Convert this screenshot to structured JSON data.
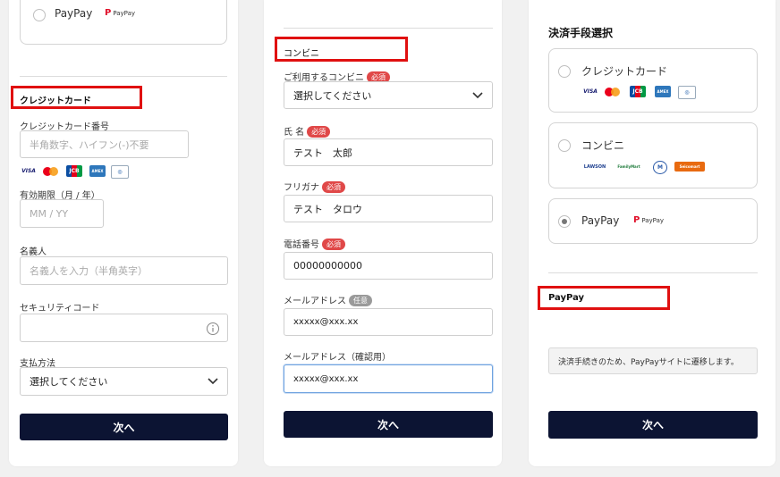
{
  "left_panel": {
    "top_option_label": "PayPay",
    "top_option_logo": "PayPay",
    "section_title": "クレジットカード",
    "card_number_label": "クレジットカード番号",
    "card_number_placeholder": "半角数字、ハイフン(-)不要",
    "card_brands": [
      "VISA",
      "Mastercard",
      "JCB",
      "AMEX",
      "Diners Club"
    ],
    "expiry_label": "有効期限（月 / 年）",
    "expiry_placeholder": "MM / YY",
    "name_label": "名義人",
    "name_placeholder": "名義人を入力（半角英字）",
    "security_label": "セキュリティコード",
    "payment_method_label": "支払方法",
    "payment_method_value": "選択してください",
    "next_button": "次へ"
  },
  "middle_panel": {
    "section_title": "コンビニ",
    "store_label": "ご利用するコンビニ",
    "required_badge": "必須",
    "optional_badge": "任意",
    "store_value": "選択してください",
    "name_label": "氏 名",
    "name_value": "テスト　太郎",
    "kana_label": "フリガナ",
    "kana_value": "テスト　タロウ",
    "phone_label": "電話番号",
    "phone_value": "00000000000",
    "email_label": "メールアドレス",
    "email_value": "xxxxx@xxx.xx",
    "email_confirm_label": "メールアドレス（確認用）",
    "email_confirm_value": "xxxxx@xxx.xx",
    "next_button": "次へ"
  },
  "right_panel": {
    "heading": "決済手段選択",
    "options": [
      {
        "label": "クレジットカード",
        "selected": false
      },
      {
        "label": "コンビニ",
        "selected": false
      },
      {
        "label": "PayPay",
        "selected": true
      }
    ],
    "card_brands": [
      "VISA",
      "Mastercard",
      "JCB",
      "AMEX",
      "Diners Club"
    ],
    "cvs_brands": [
      "LAWSON",
      "FamilyMart",
      "Ministop",
      "Seicomart"
    ],
    "paypay_logo": "PayPay",
    "section_title": "PayPay",
    "notice": "決済手続きのため、PayPayサイトに遷移します。",
    "next_button": "次へ"
  },
  "colors": {
    "button_bg": "#0c1433",
    "highlight_box": "#e01010",
    "required_badge": "#e04848",
    "paypay_red": "#e0102a"
  }
}
